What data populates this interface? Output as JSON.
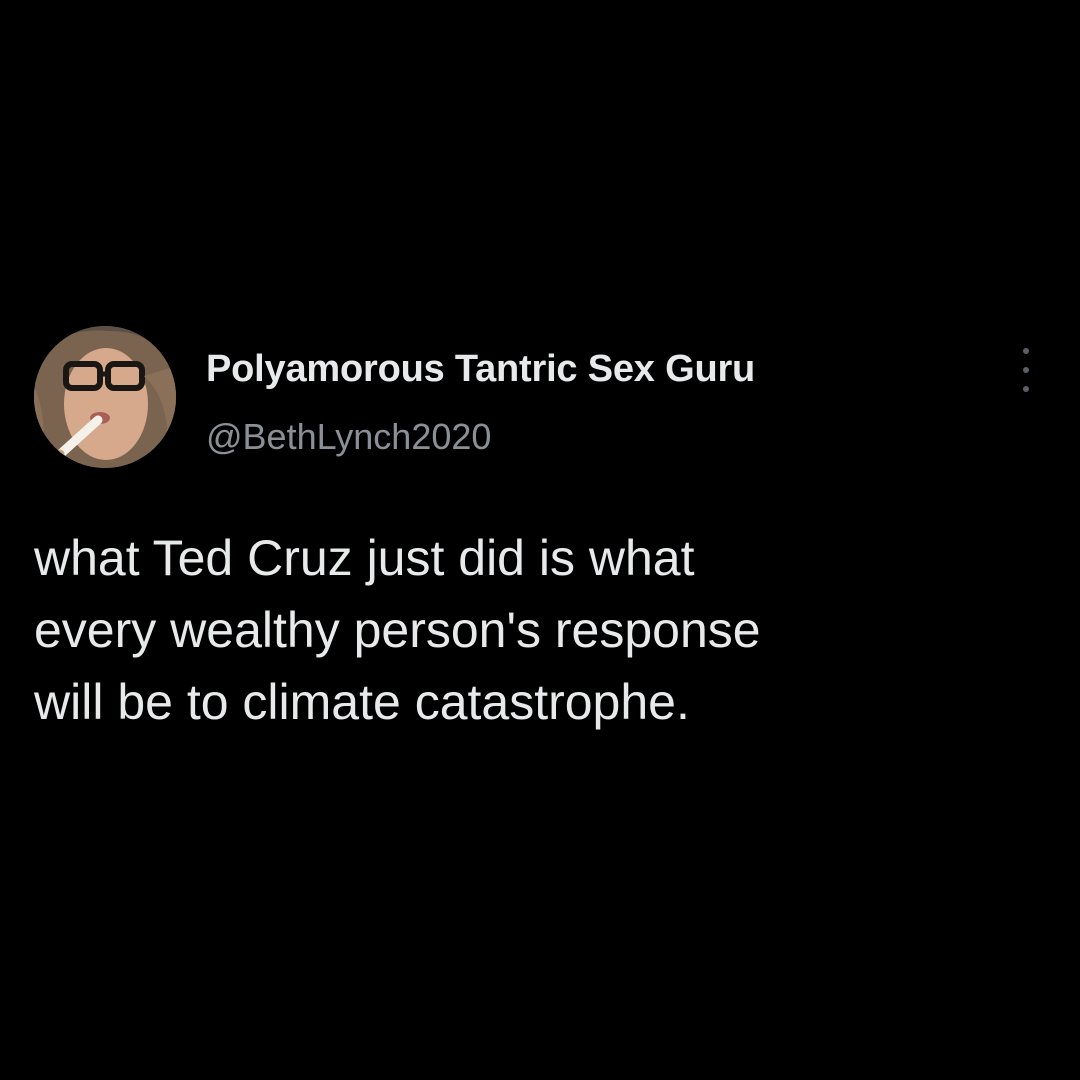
{
  "tweet": {
    "author": {
      "display_name": "Polyamorous Tantric Sex Guru",
      "handle": "@BethLynch2020",
      "avatar_icon": "profile-photo"
    },
    "more_icon": "vertical-ellipsis-icon",
    "text": "what Ted Cruz just did is what\nevery wealthy person's response\nwill be to climate catastrophe."
  },
  "colors": {
    "background": "#000000",
    "primary_text": "#e7e9ea",
    "secondary_text": "#8b9096"
  }
}
